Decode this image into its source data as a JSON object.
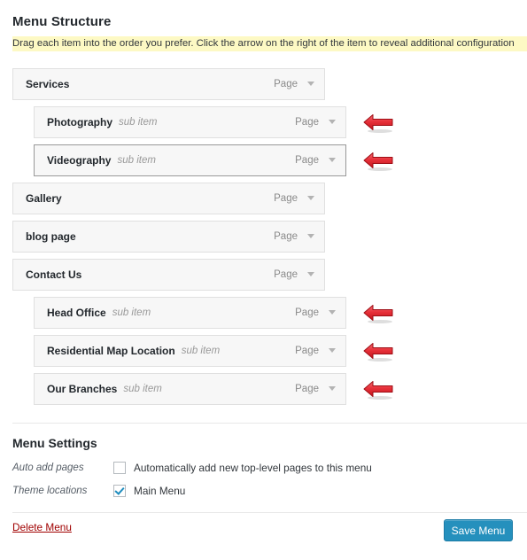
{
  "page": {
    "title": "Menu Structure",
    "instructions": "Drag each item into the order you prefer. Click the arrow on the right of the item to reveal additional configuration"
  },
  "menu_items": [
    {
      "label": "Services",
      "sub_label": "",
      "type": "Page",
      "depth": 0,
      "active": false,
      "arrow": false
    },
    {
      "label": "Photography",
      "sub_label": "sub item",
      "type": "Page",
      "depth": 1,
      "active": false,
      "arrow": true
    },
    {
      "label": "Videography",
      "sub_label": "sub item",
      "type": "Page",
      "depth": 1,
      "active": true,
      "arrow": true
    },
    {
      "label": "Gallery",
      "sub_label": "",
      "type": "Page",
      "depth": 0,
      "active": false,
      "arrow": false
    },
    {
      "label": "blog page",
      "sub_label": "",
      "type": "Page",
      "depth": 0,
      "active": false,
      "arrow": false
    },
    {
      "label": "Contact Us",
      "sub_label": "",
      "type": "Page",
      "depth": 0,
      "active": false,
      "arrow": false
    },
    {
      "label": "Head Office",
      "sub_label": "sub item",
      "type": "Page",
      "depth": 1,
      "active": false,
      "arrow": true
    },
    {
      "label": "Residential Map Location",
      "sub_label": "sub item",
      "type": "Page",
      "depth": 1,
      "active": false,
      "arrow": true
    },
    {
      "label": "Our Branches",
      "sub_label": "sub item",
      "type": "Page",
      "depth": 1,
      "active": false,
      "arrow": true
    }
  ],
  "settings": {
    "title": "Menu Settings",
    "auto_add": {
      "label": "Auto add pages",
      "checkbox_text": "Automatically add new top-level pages to this menu",
      "checked": false
    },
    "theme_locations": {
      "label": "Theme locations",
      "checkbox_text": "Main Menu",
      "checked": true
    }
  },
  "footer": {
    "delete_label": "Delete Menu",
    "save_label": "Save Menu"
  },
  "colors": {
    "banner_background": "#fdf9c4",
    "arrow_red": "#e8313a",
    "save_blue": "#2590bd",
    "delete_red": "#a00000",
    "checkmark_blue": "#1e8cbe"
  },
  "icons": {
    "toggle": "chevron-down-icon",
    "pointer": "left-arrow-icon"
  }
}
